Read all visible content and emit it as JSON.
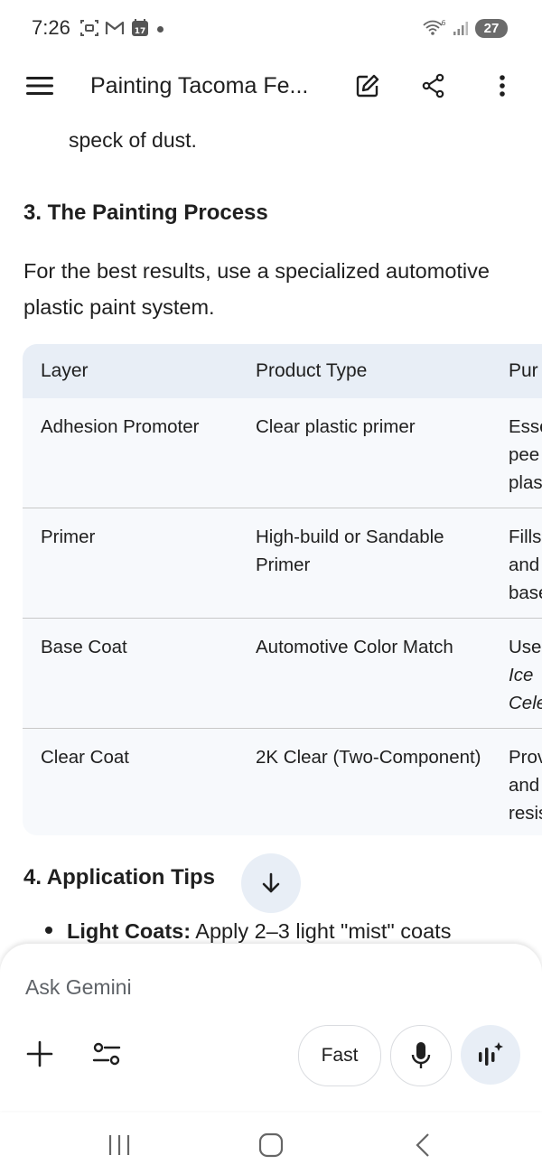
{
  "status_bar": {
    "time": "7:26",
    "calendar_day": "17",
    "network": "6",
    "battery": "27"
  },
  "app_bar": {
    "title": "Painting Tacoma Fe..."
  },
  "content": {
    "partial_line": "speck of dust.",
    "section3_heading": "3. The Painting Process",
    "intro": "For the best results, use a specialized automotive plastic paint system.",
    "table": {
      "headers": [
        "Layer",
        "Product Type",
        "Pur"
      ],
      "rows": [
        {
          "layer": "Adhesion Promoter",
          "product": "Clear plastic primer",
          "purpose": [
            "Esse",
            "pee",
            "plas"
          ]
        },
        {
          "layer": "Primer",
          "product": "High-build or Sandable Primer",
          "purpose": [
            "Fills",
            "and",
            "base"
          ]
        },
        {
          "layer": "Base Coat",
          "product": "Automotive Color Match",
          "purpose": [
            "Use",
            "Ice",
            "Cele"
          ]
        },
        {
          "layer": "Clear Coat",
          "product": "2K Clear (Two-Component)",
          "purpose": [
            "Prov",
            "and",
            "resis"
          ]
        }
      ]
    },
    "section4_heading": "4. Application Tips",
    "bullet1_bold": "Light Coats:",
    "bullet1_text": " Apply 2–3 light \"mist\" coats"
  },
  "input_panel": {
    "placeholder": "Ask Gemini",
    "fast_label": "Fast"
  },
  "colors": {
    "table_header_bg": "#e8eef6",
    "table_body_bg": "#f7f9fc",
    "accent_button_bg": "#e8eef6"
  }
}
